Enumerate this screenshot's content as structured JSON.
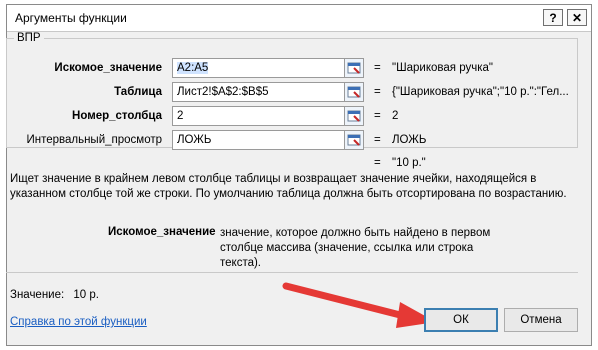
{
  "dialog": {
    "title": "Аргументы функции",
    "help_glyph": "?",
    "close_glyph": "✕"
  },
  "function_name": "ВПР",
  "arguments": [
    {
      "label": "Искомое_значение",
      "value": "A2:A5",
      "result": "\"Шариковая ручка\""
    },
    {
      "label": "Таблица",
      "value": "Лист2!$A$2:$B$5",
      "result": "{\"Шариковая ручка\";\"10 р.\":\"Гел..."
    },
    {
      "label": "Номер_столбца",
      "value": "2",
      "result": "2"
    },
    {
      "label": "Интервальный_просмотр",
      "value": "ЛОЖЬ",
      "result": "ЛОЖЬ"
    }
  ],
  "equals": "=",
  "formula_result": "\"10 р.\"",
  "description": "Ищет значение в крайнем левом столбце таблицы и возвращает значение ячейки, находящейся в указанном столбце той же строки. По умолчанию таблица должна быть отсортирована по возрастанию.",
  "arg_help": {
    "name": "Искомое_значение",
    "text": "значение, которое должно быть найдено в первом столбце массива (значение, ссылка или строка текста)."
  },
  "value_line": {
    "label": "Значение:",
    "value": "10 р."
  },
  "help_link": "Справка по этой функции",
  "buttons": {
    "ok": "ОК",
    "cancel": "Отмена"
  },
  "colors": {
    "link": "#1a5ec2",
    "arrow": "#e53935",
    "ok_border": "#3c7fb1"
  }
}
